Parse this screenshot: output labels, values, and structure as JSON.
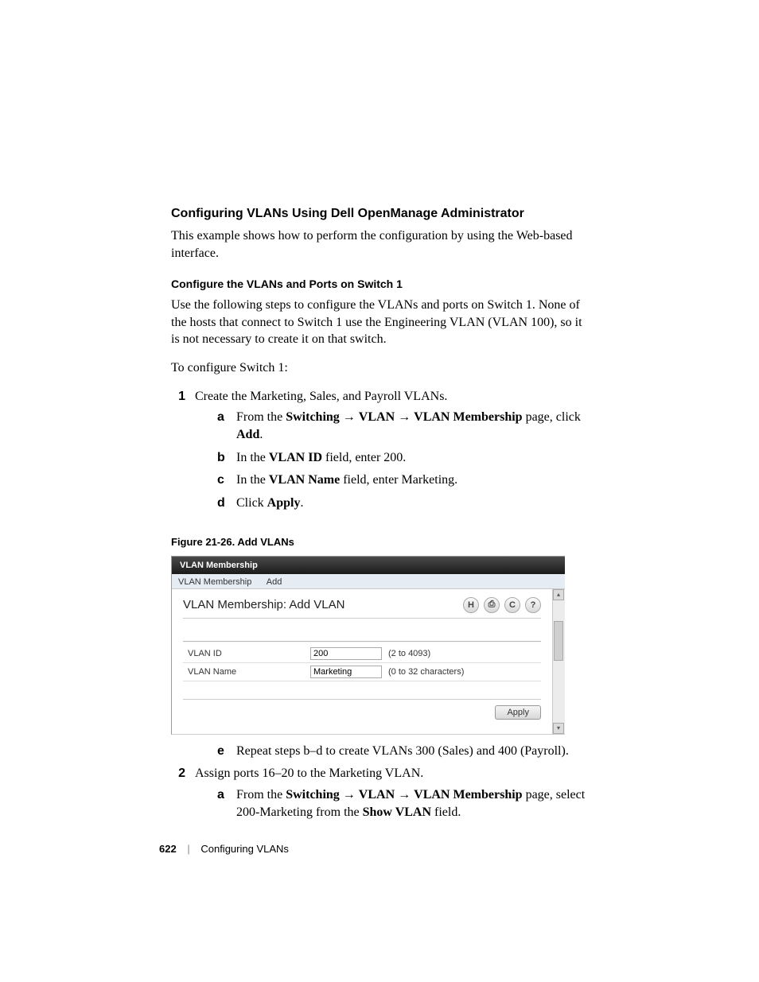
{
  "heading": "Configuring VLANs Using Dell OpenManage Administrator",
  "intro": "This example shows how to perform the configuration by using the Web-based interface.",
  "subheading": "Configure the VLANs and Ports on Switch 1",
  "para1": "Use the following steps to configure the VLANs and ports on Switch 1. None of the hosts that connect to Switch 1 use the Engineering VLAN (VLAN 100), so it is not necessary to create it on that switch.",
  "para2": "To configure Switch 1:",
  "step1": {
    "num": "1",
    "text": "Create the Marketing, Sales, and Payroll VLANs.",
    "a": {
      "let": "a",
      "pre": "From the ",
      "b1": "Switching",
      "arr1": " → ",
      "b2": "VLAN",
      "arr2": " → ",
      "b3": "VLAN Membership",
      "mid": " page, click ",
      "b4": "Add",
      "post": "."
    },
    "b": {
      "let": "b",
      "pre": "In the ",
      "b1": "VLAN ID",
      "post": " field, enter 200."
    },
    "c": {
      "let": "c",
      "pre": "In the ",
      "b1": "VLAN Name",
      "post": " field, enter Marketing."
    },
    "d": {
      "let": "d",
      "pre": "Click ",
      "b1": "Apply",
      "post": "."
    },
    "e": {
      "let": "e",
      "text": "Repeat steps b–d to create VLANs 300 (Sales) and 400 (Payroll)."
    }
  },
  "step2": {
    "num": "2",
    "text": "Assign ports 16–20 to the Marketing VLAN.",
    "a": {
      "let": "a",
      "pre": "From the ",
      "b1": "Switching",
      "arr1": " → ",
      "b2": "VLAN",
      "arr2": " → ",
      "b3": "VLAN Membership",
      "mid": " page, select 200-Marketing from the ",
      "b4": "Show VLAN",
      "post": " field."
    }
  },
  "figcap": "Figure 21-26.    Add VLANs",
  "figure": {
    "titlebar": "VLAN Membership",
    "tab1": "VLAN Membership",
    "tab2": "Add",
    "pagetitle": "VLAN Membership: Add VLAN",
    "icons": {
      "save": "H",
      "print": "⎙",
      "refresh": "C",
      "help": "?"
    },
    "row1": {
      "label": "VLAN ID",
      "value": "200",
      "hint": "(2 to 4093)"
    },
    "row2": {
      "label": "VLAN Name",
      "value": "Marketing",
      "hint": "(0 to 32 characters)"
    },
    "apply": "Apply"
  },
  "footer": {
    "page": "622",
    "title": "Configuring VLANs"
  }
}
